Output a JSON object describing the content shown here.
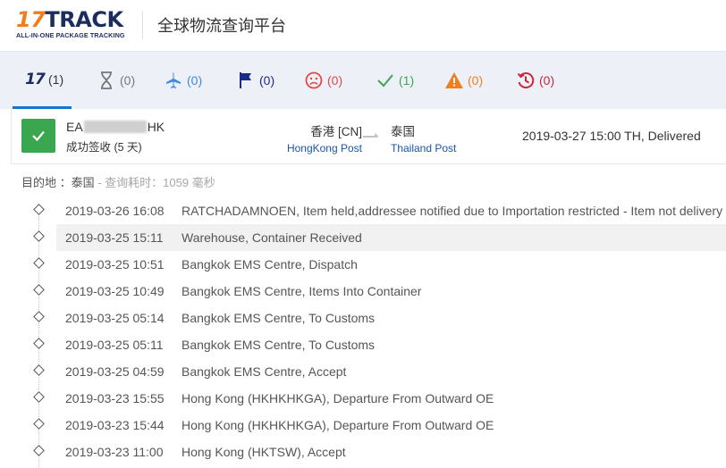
{
  "header": {
    "logo_number": "17",
    "logo_word": "TRACK",
    "logo_tagline": "ALL-IN-ONE PACKAGE TRACKING",
    "title": "全球物流查询平台"
  },
  "tabs": [
    {
      "id": "all",
      "icon": "logo-17-icon",
      "count": "(1)",
      "color": "#1c2c5e"
    },
    {
      "id": "pending",
      "icon": "hourglass-icon",
      "count": "(0)",
      "color": "#777777"
    },
    {
      "id": "in-transit",
      "icon": "airplane-icon",
      "count": "(0)",
      "color": "#3c8be0"
    },
    {
      "id": "pick-up",
      "icon": "flag-icon",
      "count": "(0)",
      "color": "#1b2c86"
    },
    {
      "id": "undelivered",
      "icon": "sad-face-icon",
      "count": "(0)",
      "color": "#e14848"
    },
    {
      "id": "delivered",
      "icon": "checkmark-icon",
      "count": "(1)",
      "color": "#3aa650"
    },
    {
      "id": "alert",
      "icon": "warning-icon",
      "count": "(0)",
      "color": "#f07e20"
    },
    {
      "id": "expired",
      "icon": "history-icon",
      "count": "(0)",
      "color": "#c8263a"
    }
  ],
  "shipment": {
    "tracking_prefix": "EA",
    "tracking_suffix": "HK",
    "status": "成功签收 (5 天)",
    "status_color": "#3aa650",
    "origin_country": "香港 [CN]",
    "origin_carrier": "HongKong Post",
    "destination_country": "泰国",
    "destination_carrier": "Thailand Post",
    "latest_event": "2019-03-27 15:00  TH, Delivered"
  },
  "info": {
    "destination_label": "目的地 ：泰国",
    "query_time": " - 查询耗时：1059 毫秒"
  },
  "events": [
    {
      "time": "2019-03-26 16:08",
      "description": "RATCHADAMNOEN, Item held,addressee notified due to Importation restricted - Item not delivery"
    },
    {
      "time": "2019-03-25 15:11",
      "description": "Warehouse, Container Received"
    },
    {
      "time": "2019-03-25 10:51",
      "description": "Bangkok EMS Centre, Dispatch"
    },
    {
      "time": "2019-03-25 10:49",
      "description": "Bangkok EMS Centre, Items Into Container"
    },
    {
      "time": "2019-03-25 05:14",
      "description": "Bangkok EMS Centre, To Customs"
    },
    {
      "time": "2019-03-25 05:11",
      "description": "Bangkok EMS Centre, To Customs"
    },
    {
      "time": "2019-03-25 04:59",
      "description": "Bangkok EMS Centre, Accept"
    },
    {
      "time": "2019-03-23 15:55",
      "description": "Hong Kong (HKHKHKGA), Departure From Outward OE"
    },
    {
      "time": "2019-03-23 15:44",
      "description": "Hong Kong (HKHKHKGA), Departure From Outward OE"
    },
    {
      "time": "2019-03-23 11:00",
      "description": "Hong Kong (HKTSW), Accept"
    }
  ]
}
